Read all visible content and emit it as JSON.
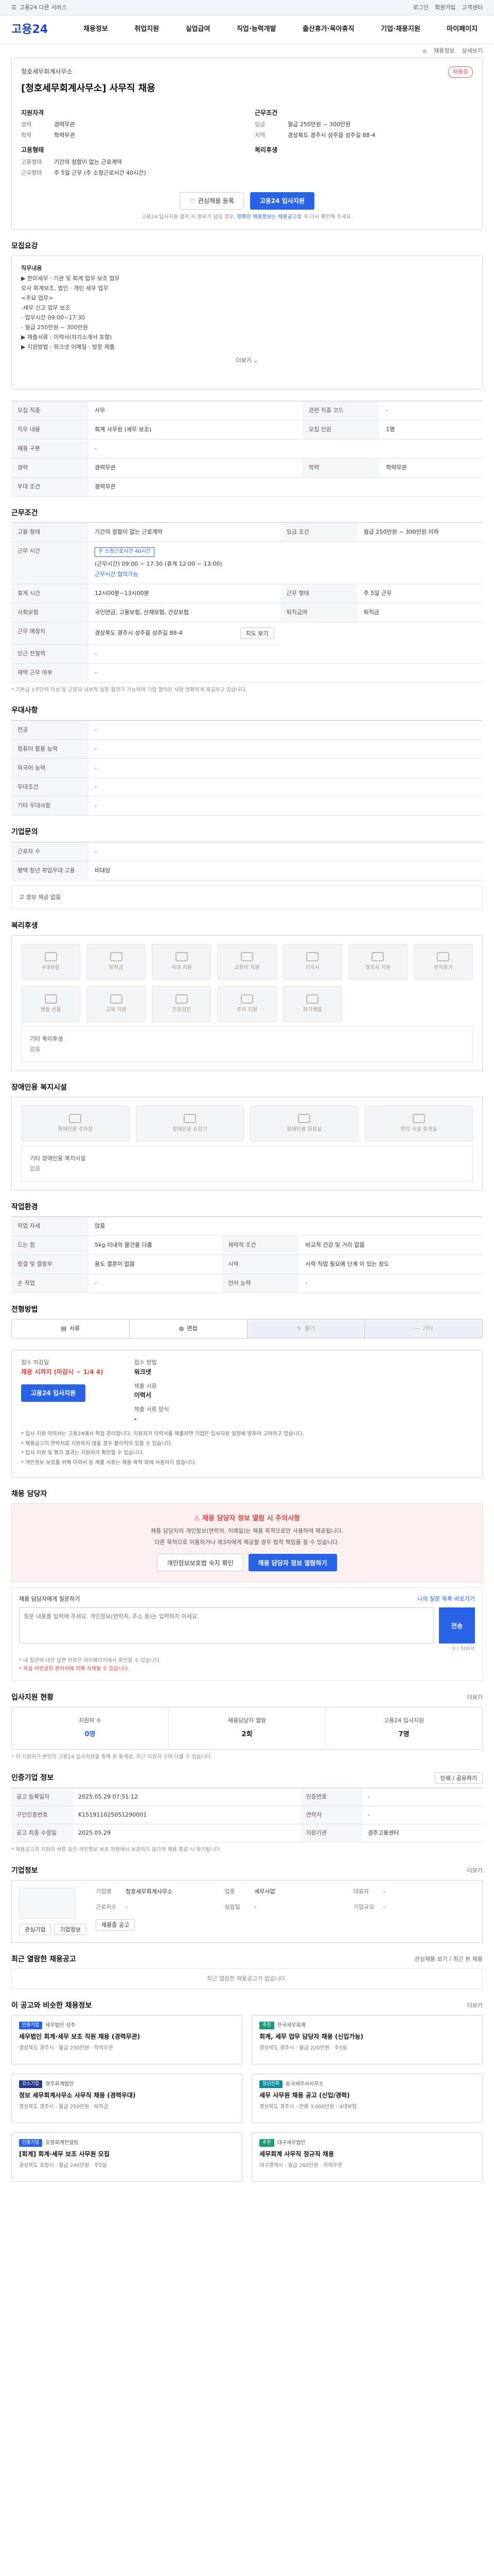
{
  "topbar": {
    "left": "고용24 다른 서비스",
    "right": [
      "로그인",
      "회원가입",
      "고객센터"
    ]
  },
  "brand": {
    "logo": "고용24"
  },
  "gnb": [
    "채용정보",
    "취업지원",
    "실업급여",
    "직업·능력개발",
    "출산휴가·육아휴직",
    "기업·채용지원",
    "마이페이지"
  ],
  "crumb": [
    "채용정보",
    "상세보기"
  ],
  "header": {
    "company": "청호세무회계사무소",
    "badge": "채용중",
    "title": "[청호세무회계사무소] 사무직 채용",
    "left": {
      "sub": "지원자격",
      "rows": [
        {
          "k": "경력",
          "v": "경력무관"
        },
        {
          "k": "학력",
          "v": "학력무관"
        }
      ],
      "sub2": "고용형태",
      "rows2": [
        {
          "k": "고용형태",
          "v": "기간의 정함이 없는 근로계약"
        },
        {
          "k": "근무형태",
          "v": "주 5일 근무 (주 소정근로시간 40시간)"
        }
      ]
    },
    "right": {
      "sub": "근무조건",
      "rows": [
        {
          "k": "임금",
          "v": "월급 250만원 ~ 300만원"
        },
        {
          "k": "지역",
          "v": "경상북도 경주시 성주읍 성주길 88-4"
        }
      ],
      "sub2": "복리후생",
      "rows2": []
    },
    "scrap": "관심채용 등록",
    "apply": "고용24 입사지원",
    "note_a": "고용24 입사지원 클릭 시 정보가 넘길 경우,",
    "note_b": "정확한 채용정보는 채용공고",
    "note_c": "를 꼭 다시 확인해 주세요."
  },
  "desc": {
    "title": "모집요강",
    "head": "직무내용",
    "lines": [
      "▶ 한미세무 · 기관 및 회계 업무 보조 업무",
      "",
      "모사 회계보조, 법인 · 개인 세무 업무",
      "<주요 업무>",
      "-세무 신고 업무 보조",
      "- 업무시간 09:00~17:30",
      "- 월급 250만원 ~ 300만원",
      "",
      "▶ 제출서류 : 이력서(자기소개서 포함)",
      "▶ 지원방법 : 워크넷 이메일 · 방문 제출"
    ],
    "more": "더보기"
  },
  "recruit": {
    "rows": [
      {
        "k": "모집 직종",
        "v": "사무",
        "k2": "관련 직종 코드",
        "v2": "-"
      },
      {
        "k": "직무 내용",
        "v": "회계 사무원 (세무 보조)",
        "k2": "모집 인원",
        "v2": "1명"
      },
      {
        "k": "채용 구분",
        "v": "-",
        "k2": "",
        "v2": ""
      },
      {
        "k": "경력",
        "v": "경력무관",
        "k2": "학력",
        "v2": "학력무관"
      },
      {
        "k": "우대 조건",
        "v": "경력무관",
        "k2": "",
        "v2": ""
      }
    ]
  },
  "conditions": {
    "title": "근무조건",
    "rows": [
      {
        "k": "고용 형태",
        "v": "기간의 정함이 없는 근로계약",
        "k2": "임금 조건",
        "v2": "월급 250만원 ~ 300만원 이하"
      },
      {
        "k": "근무 시간",
        "tag": "주 소정근로시간 40시간",
        "v": "(근무시간) 09:00 ~ 17:30 (휴게 12:00 ~ 13:00)",
        "extra": "근무시간 협의가능"
      },
      {
        "k": "휴게 시간",
        "v": "12시00분~13시00분",
        "k2": "근무 형태",
        "v2": "주 5일 근무"
      },
      {
        "k": "사회보험",
        "v": "국민연금, 고용보험, 산재보험, 건강보험",
        "k2": "퇴직급여",
        "v2": "퇴직금"
      },
      {
        "k": "근무 예정지",
        "v": "경상북도 경주시 성주읍 성주길 88-4",
        "btn": "지도 보기"
      },
      {
        "k": "인근 전철역",
        "v": "-",
        "k2": "",
        "v2": ""
      },
      {
        "k": "재택 근무 여부",
        "v": "-",
        "k2": "",
        "v2": ""
      }
    ],
    "note": "* 기본급 1주단위 이상 및 근로자 내부적 일정 협의가 가능하며 기업 협의된 사항 명확하게 제공하고 있습니다."
  },
  "pref": {
    "title": "우대사항",
    "rows": [
      {
        "k": "전공",
        "v": "-"
      },
      {
        "k": "컴퓨터 활용 능력",
        "v": "-"
      },
      {
        "k": "외국어 능력",
        "v": "-"
      },
      {
        "k": "우대조건",
        "v": "-"
      },
      {
        "k": "기타 우대사항",
        "v": "-"
      }
    ]
  },
  "process": {
    "title": "기업문의",
    "rows": [
      {
        "k": "근로자 수",
        "v": "-"
      },
      {
        "k": "평택 청년 취업우대 고용",
        "v": "비대상"
      }
    ],
    "empty": "고 정보 제공 없음"
  },
  "welfare": {
    "title": "복리후생",
    "items": [
      "4대보험",
      "퇴직금",
      "식대 지원",
      "교통비 지원",
      "기숙사",
      "경조사 지원",
      "연차휴가",
      "명절 선물",
      "교육 지원",
      "건강검진",
      "주차 지원",
      "자기계발"
    ],
    "empty": "기타 복리후생",
    "empty2": "없음"
  },
  "disability": {
    "title": "장애인용 복지시설",
    "items": [
      "장애인용 주차장",
      "장애인용 승강기",
      "장애인용 화장실",
      "편의 시설 휴게실"
    ],
    "empty": "기타 장애인용 복지시설",
    "empty2": "없음"
  },
  "workenv": {
    "title": "작업환경",
    "rows": [
      {
        "k": "작업 자세",
        "v": "앉음",
        "k2": "",
        "v2": ""
      },
      {
        "k": "드는 힘",
        "v": "5kg 이내의 물건을 다룸",
        "k2": "체력적 조건",
        "v2": "비교적 건강 및 거리 없음"
      },
      {
        "k": "청결 및 결함부",
        "v": "용도 결혼이 없음",
        "k2": "시력",
        "v2": "시력 직업 필요에 단계 이 있는 정도"
      },
      {
        "k": "손 작업",
        "v": "-",
        "k2": "언어 능력",
        "v2": "-"
      }
    ]
  },
  "steps": {
    "title": "전형방법",
    "items": [
      "서류",
      "면접",
      "필기",
      "기타"
    ]
  },
  "apply": {
    "title": "접수 방법",
    "items": [
      {
        "k": "접수 마감일",
        "v": "채용 시까지 (마감시 ~ 1/4 4)",
        "red": true
      },
      {
        "k": "접수 방법",
        "v": "워크넷",
        "red": false
      },
      {
        "k": "제출 서류",
        "v": "이력서",
        "red": false
      },
      {
        "k": "제출 서류 양식",
        "v": "-",
        "red": false
      }
    ],
    "apply_btn": "고용24 입사지원",
    "warns": [
      "* 입사 지원 이력서는 고용24에서 직접 관리합니다. 지원자가 이력서를 제출하면 기업은 입사지원 일정에 맞추어 고려하고 있습니다.",
      "* 채용공고의 연락처로 지원하지 않을 경우 불이익이 있을 수 있습니다.",
      "* 입사 지원 및 평가 결과는 지원자가 확인할 수 있습니다.",
      "* 개인정보 보호를 위해 이력서 등 제출 서류는 채용 목적 외에 사용하지 않습니다."
    ]
  },
  "manager": {
    "title": "채용 담당자",
    "pink_title": "채용 담당자 정보 열람 시 주의사항",
    "pink_lines": [
      "채용 담당자의 개인정보(연락처, 이메일)는 채용 목적으로만 사용하여 제공됩니다.",
      "다른 목적으로 이용하거나 제3자에게 제공할 경우 법적 책임을 질 수 있습니다."
    ],
    "btn1": "개인정보보호법 숙지 확인",
    "btn2": "채용 담당자 정보 열람하기",
    "qa_label": "채용 담당자에게 질문하기",
    "qa_link": "나의 질문 목록 바로가기",
    "qa_placeholder": "질문 내용을 입력해 주세요. 개인정보(연락처, 주소 등)는 입력하지 마세요.",
    "qa_send": "전송",
    "qa_count": "0 / 500자",
    "qa_notes": [
      "* 내 질문에 대한 답변 현황은 마이페이지에서 확인할 수 있습니다.",
      "* 욕설 비방글은 관리자에 의해 삭제될 수 있습니다."
    ]
  },
  "stats": {
    "title": "입사지원 현황",
    "more": "더보기",
    "items": [
      {
        "k": "지원자 수",
        "v": "0명",
        "blue": true
      },
      {
        "k": "채용담당자 열람",
        "v": "2회",
        "blue": false
      },
      {
        "k": "고용24 입사지원",
        "v": "7명",
        "blue": false
      }
    ],
    "note": "* 이 지원자가 본인의 고용24 입사지원을 통해 본 통계로, 최근 지원자 수와 다를 수 있습니다."
  },
  "meta": {
    "title": "인증기업 정보",
    "btn": "인쇄 / 공유하기",
    "rows": [
      {
        "k": "공고 등록일자",
        "v": "2025.05.29 07:51:12",
        "k2": "인증번호",
        "v2": "-"
      },
      {
        "k": "구인인증번호",
        "v": "K151911025051290001",
        "k2": "연락처",
        "v2": "-"
      },
      {
        "k": "공고 최종 수정일",
        "v": "2025.05.29",
        "k2": "지원기관",
        "v2": "경주고용센터"
      }
    ],
    "note": "* 채용공고의 지원자 서류 등은 개인정보 보호 차원에서 보관하지 않으며 채용 종료 시 파기됩니다."
  },
  "company": {
    "title": "기업정보",
    "more": "더보기",
    "rows": [
      {
        "k": "기업명",
        "v": "청호세무회계사무소"
      },
      {
        "k": "업종",
        "v": "세무사업"
      },
      {
        "k": "대표자",
        "v": "-"
      },
      {
        "k": "근로자수",
        "v": "-"
      },
      {
        "k": "설립일",
        "v": "-"
      },
      {
        "k": "기업규모",
        "v": "-"
      }
    ],
    "btn1": "관심기업",
    "btn2": "기업정보",
    "btn3": "채용중 공고"
  },
  "recent": {
    "title": "최근 열람한 채용공고",
    "more": "관심채용 보기 / 최근 본 채용",
    "empty": "최근 열람한 채용공고가 없습니다."
  },
  "recommend": {
    "title": "이 공고와 비슷한 채용정보",
    "more": "더보기",
    "cards": [
      {
        "chip": "인증기업",
        "chip_color": "blue",
        "co": "세무법인 성주",
        "t": "세무법인 회계·세무 보조 직원 채용 (경력무관)",
        "m": "경상북도 경주시 · 월급 230만원 · 학력무관"
      },
      {
        "chip": "추천",
        "chip_color": "green",
        "co": "한국세무회계",
        "t": "회계, 세무 업무 담당자 채용 (신입가능)",
        "m": "경상북도 경주시 · 월급 220만원 · 주5일"
      },
      {
        "chip": "강소기업",
        "chip_color": "navy",
        "co": "경주회계법인",
        "t": "정보 세무회계사무소 사무직 채용 (경력우대)",
        "m": "경상북도 경주시 · 월급 250만원 · 퇴직금"
      },
      {
        "chip": "청년친화",
        "chip_color": "teal",
        "co": "동국세무사사무소",
        "t": "세무 사무원 채용 공고 (신입/경력)",
        "m": "경상북도 경주시 · 연봉 3,000만원 · 4대보험"
      },
      {
        "chip": "인증기업",
        "chip_color": "blue",
        "co": "포항회계컨설팅",
        "t": "[회계] 회계·세무 보조 사무원 모집",
        "m": "경상북도 포항시 · 월급 240만원 · 주5일"
      },
      {
        "chip": "추천",
        "chip_color": "green",
        "co": "대구세무법인",
        "t": "세무회계 사무직 정규직 채용",
        "m": "대구광역시 · 월급 260만원 · 학력무관"
      }
    ]
  }
}
